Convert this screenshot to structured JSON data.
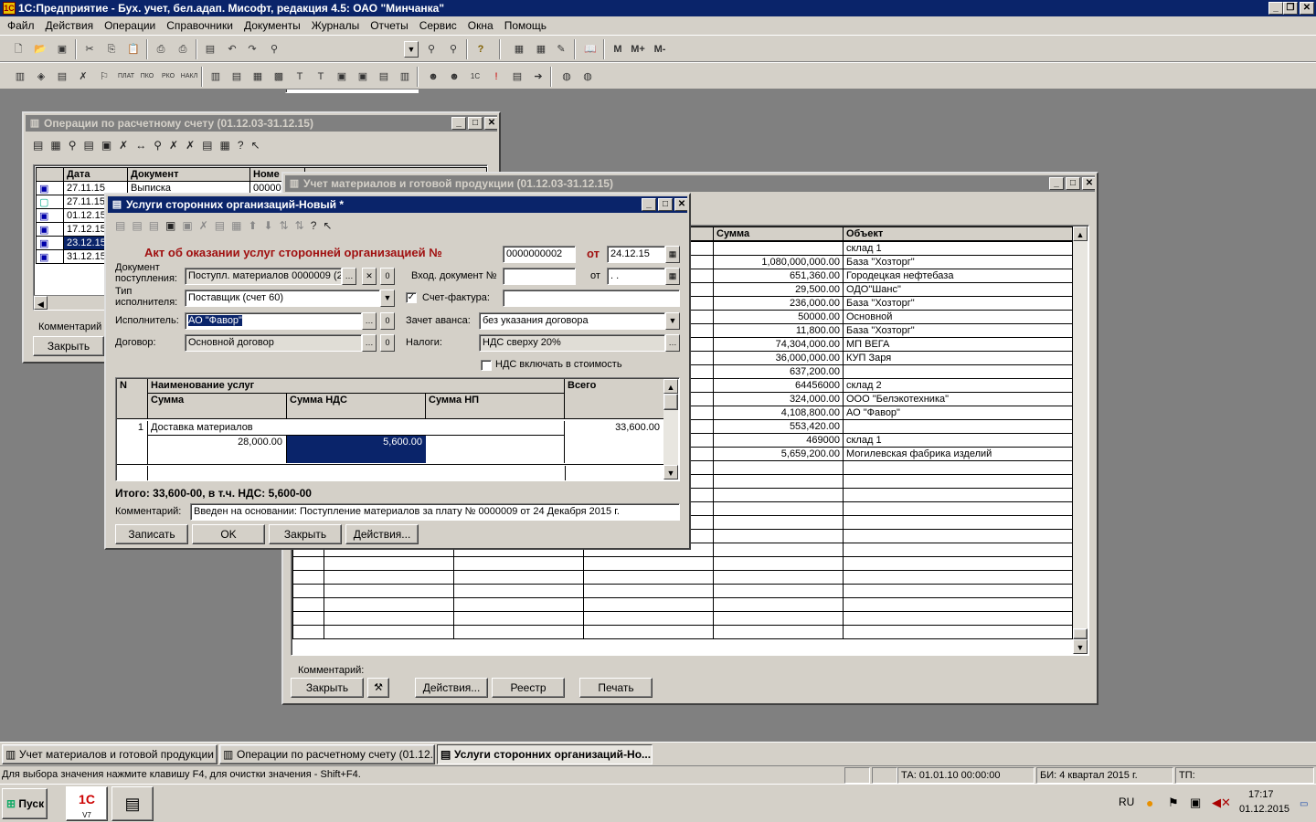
{
  "app": {
    "title": "1С:Предприятие - Бух. учет, бел.адап. Мисофт, редакция 4.5: ОАО \"Минчанка\"",
    "menu": [
      "Файл",
      "Действия",
      "Операции",
      "Справочники",
      "Документы",
      "Журналы",
      "Отчеты",
      "Сервис",
      "Окна",
      "Помощь"
    ],
    "toolbar_memory": [
      "M",
      "M+",
      "M-"
    ]
  },
  "ops_window": {
    "title": "Операции по расчетному счету (01.12.03-31.12.15)",
    "columns": [
      "Дата",
      "Документ",
      "Номе"
    ],
    "rows": [
      {
        "date": "27.11.15",
        "doc": "Выписка",
        "num": "00000"
      },
      {
        "date": "27.11.15",
        "doc": "",
        "num": ""
      },
      {
        "date": "01.12.15",
        "doc": "",
        "num": ""
      },
      {
        "date": "17.12.15",
        "doc": "",
        "num": ""
      },
      {
        "date": "23.12.15",
        "doc": "",
        "num": ""
      },
      {
        "date": "31.12.15",
        "doc": "",
        "num": ""
      }
    ],
    "comment_label": "Комментарий",
    "close_btn": "Закрыть"
  },
  "materials_window": {
    "title": "Учет материалов и готовой продукции (01.12.03-31.12.15)",
    "col_sum": "Сумма",
    "col_object": "Объект",
    "rows": [
      {
        "sum": "",
        "obj": "склад 1"
      },
      {
        "sum": "1,080,000,000.00",
        "obj": "База \"Хозторг\""
      },
      {
        "sum": "651,360.00",
        "obj": "Городецкая нефтебаза"
      },
      {
        "sum": "29,500.00",
        "obj": "ОДО\"Шанс\""
      },
      {
        "sum": "236,000.00",
        "obj": "База \"Хозторг\""
      },
      {
        "sum": "50000.00",
        "obj": "Основной"
      },
      {
        "sum": "11,800.00",
        "obj": "База \"Хозторг\""
      },
      {
        "sum": "74,304,000.00",
        "obj": "МП ВЕГА"
      },
      {
        "sum": "36,000,000.00",
        "obj": "КУП Заря"
      },
      {
        "sum": "637,200.00",
        "obj": ""
      },
      {
        "sum": "64456000",
        "obj": "склад 2"
      },
      {
        "sum": "324,000.00",
        "obj": "ООО \"Белэкотехника\""
      },
      {
        "sum": "4,108,800.00",
        "obj": "АО \"Фавор\""
      },
      {
        "sum": "553,420.00",
        "obj": ""
      },
      {
        "sum": "469000",
        "obj": "склад 1"
      },
      {
        "sum": "5,659,200.00",
        "obj": "Могилевская фабрика изделий"
      }
    ],
    "comment_label": "Комментарий:",
    "buttons": {
      "close": "Закрыть",
      "actions": "Действия...",
      "registry": "Реестр",
      "print": "Печать"
    }
  },
  "dialog": {
    "title": "Услуги сторонних организаций-Новый *",
    "heading": "Акт об оказании услуг сторонней организацией №",
    "doc_number": "0000000002",
    "from_label": "от",
    "doc_date": "24.12.15",
    "receipt_label_1": "Документ",
    "receipt_label_2": "поступления:",
    "receipt_value": "Поступл. материалов 0000009 (2",
    "incoming_label": "Вход. документ №",
    "incoming_value": "",
    "incoming_from": "от",
    "incoming_date": " .  . ",
    "exec_type_label_1": "Тип",
    "exec_type_label_2": "исполнителя:",
    "exec_type_value": "Поставщик (счет 60)",
    "invoice_label": "Счет-фактура:",
    "invoice_value": "",
    "executor_label": "Исполнитель:",
    "executor_value": "АО \"Фавор\"",
    "advance_label": "Зачет аванса:",
    "advance_value": "без указания договора",
    "contract_label": "Договор:",
    "contract_value": "Основной договор",
    "taxes_label": "Налоги:",
    "taxes_value": "НДС сверху 20%",
    "vat_include_label": "НДС включать в стоимость",
    "zero": "0",
    "grid_cols": {
      "n": "N",
      "name": "Наименование услуг",
      "sum": "Сумма",
      "vat": "Сумма НДС",
      "np": "Сумма НП",
      "total": "Всего"
    },
    "grid_row": {
      "n": "1",
      "name": "Доставка материалов",
      "sum": "28,000.00",
      "vat": "5,600.00",
      "np": "",
      "total": "33,600.00"
    },
    "total_text": "Итого: 33,600-00, в т.ч. НДС: 5,600-00",
    "comment_label": "Комментарий:",
    "comment_value": "Введен на основании: Поступление материалов за плату № 0000009 от 24 Декабря 2015 г.",
    "buttons": {
      "save": "Записать",
      "ok": "OK",
      "close": "Закрыть",
      "actions": "Действия..."
    }
  },
  "taskbar_windows": [
    "Учет материалов и готовой продукции ...",
    "Операции по расчетному счету (01.12....",
    "Услуги сторонних организаций-Но..."
  ],
  "status": {
    "hint": "Для выбора значения нажмите клавишу F4, для очистки значения - Shift+F4.",
    "ta": "ТА: 01.01.10  00:00:00",
    "bi": "БИ: 4 квартал 2015 г.",
    "tp": "ТП:"
  },
  "os": {
    "start": "Пуск",
    "lang": "RU",
    "time": "17:17",
    "date": "01.12.2015",
    "quick_launch_label": "V7"
  }
}
